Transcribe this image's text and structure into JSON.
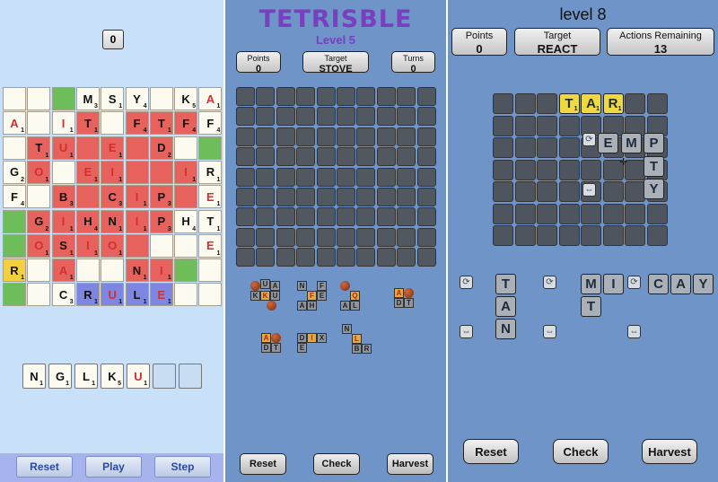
{
  "left": {
    "score": "0",
    "board_letters": [
      {
        "r": 0,
        "c": 3,
        "l": "M",
        "s": "3"
      },
      {
        "r": 0,
        "c": 4,
        "l": "S",
        "s": "1"
      },
      {
        "r": 0,
        "c": 5,
        "l": "Y",
        "s": "4"
      },
      {
        "r": 0,
        "c": 7,
        "l": "K",
        "s": "5"
      },
      {
        "r": 0,
        "c": 8,
        "l": "A",
        "s": "1",
        "red": true
      },
      {
        "r": 1,
        "c": 0,
        "l": "A",
        "s": "1",
        "red": true
      },
      {
        "r": 1,
        "c": 2,
        "l": "I",
        "s": "1",
        "red": true
      },
      {
        "r": 1,
        "c": 3,
        "l": "T",
        "s": "1"
      },
      {
        "r": 1,
        "c": 5,
        "l": "F",
        "s": "4"
      },
      {
        "r": 1,
        "c": 6,
        "l": "T",
        "s": "1"
      },
      {
        "r": 1,
        "c": 7,
        "l": "F",
        "s": "4"
      },
      {
        "r": 1,
        "c": 8,
        "l": "F",
        "s": "4"
      },
      {
        "r": 2,
        "c": 1,
        "l": "T",
        "s": "1"
      },
      {
        "r": 2,
        "c": 2,
        "l": "U",
        "s": "1",
        "red": true
      },
      {
        "r": 2,
        "c": 4,
        "l": "E",
        "s": "1",
        "red": true
      },
      {
        "r": 2,
        "c": 6,
        "l": "D",
        "s": "2"
      },
      {
        "r": 3,
        "c": 0,
        "l": "G",
        "s": "2"
      },
      {
        "r": 3,
        "c": 1,
        "l": "O",
        "s": "1",
        "red": true
      },
      {
        "r": 3,
        "c": 3,
        "l": "E",
        "s": "1",
        "red": true
      },
      {
        "r": 3,
        "c": 4,
        "l": "I",
        "s": "1",
        "red": true
      },
      {
        "r": 3,
        "c": 7,
        "l": "I",
        "s": "1",
        "red": true
      },
      {
        "r": 3,
        "c": 8,
        "l": "R",
        "s": "1"
      },
      {
        "r": 4,
        "c": 0,
        "l": "F",
        "s": "4"
      },
      {
        "r": 4,
        "c": 2,
        "l": "B",
        "s": "3"
      },
      {
        "r": 4,
        "c": 4,
        "l": "C",
        "s": "3"
      },
      {
        "r": 4,
        "c": 5,
        "l": "I",
        "s": "1",
        "red": true
      },
      {
        "r": 4,
        "c": 6,
        "l": "P",
        "s": "3"
      },
      {
        "r": 4,
        "c": 8,
        "l": "E",
        "s": "1",
        "red": true
      },
      {
        "r": 5,
        "c": 1,
        "l": "G",
        "s": "2"
      },
      {
        "r": 5,
        "c": 2,
        "l": "I",
        "s": "1",
        "red": true
      },
      {
        "r": 5,
        "c": 3,
        "l": "H",
        "s": "4"
      },
      {
        "r": 5,
        "c": 4,
        "l": "N",
        "s": "1"
      },
      {
        "r": 5,
        "c": 5,
        "l": "I",
        "s": "1",
        "red": true
      },
      {
        "r": 5,
        "c": 6,
        "l": "P",
        "s": "3"
      },
      {
        "r": 5,
        "c": 7,
        "l": "H",
        "s": "4"
      },
      {
        "r": 5,
        "c": 8,
        "l": "T",
        "s": "1"
      },
      {
        "r": 6,
        "c": 1,
        "l": "O",
        "s": "1",
        "red": true
      },
      {
        "r": 6,
        "c": 2,
        "l": "S",
        "s": "1"
      },
      {
        "r": 6,
        "c": 3,
        "l": "I",
        "s": "1",
        "red": true
      },
      {
        "r": 6,
        "c": 4,
        "l": "O",
        "s": "1",
        "red": true
      },
      {
        "r": 6,
        "c": 8,
        "l": "E",
        "s": "1",
        "red": true
      },
      {
        "r": 7,
        "c": 0,
        "l": "R",
        "s": "1"
      },
      {
        "r": 7,
        "c": 2,
        "l": "A",
        "s": "1",
        "red": true
      },
      {
        "r": 7,
        "c": 5,
        "l": "N",
        "s": "1"
      },
      {
        "r": 7,
        "c": 6,
        "l": "I",
        "s": "1",
        "red": true
      },
      {
        "r": 8,
        "c": 2,
        "l": "C",
        "s": "3"
      },
      {
        "r": 8,
        "c": 3,
        "l": "R",
        "s": "1"
      },
      {
        "r": 8,
        "c": 4,
        "l": "U",
        "s": "1",
        "red": true
      },
      {
        "r": 8,
        "c": 5,
        "l": "L",
        "s": "1"
      },
      {
        "r": 8,
        "c": 6,
        "l": "E",
        "s": "1",
        "red": true
      }
    ],
    "rack": [
      {
        "l": "N",
        "s": "1"
      },
      {
        "l": "G",
        "s": "1"
      },
      {
        "l": "L",
        "s": "1"
      },
      {
        "l": "K",
        "s": "5"
      },
      {
        "l": "U",
        "s": "1",
        "red": true
      },
      {
        "l": "",
        "s": ""
      },
      {
        "l": "",
        "s": ""
      }
    ],
    "buttons": {
      "reset": "Reset",
      "play": "Play",
      "step": "Step"
    }
  },
  "middle": {
    "title": "TETRISBLE",
    "level": "Level 5",
    "points_label": "Points",
    "points": "0",
    "target_label": "Target",
    "target": "STOVE",
    "turns_label": "Turns",
    "turns": "0",
    "pieces": [
      [
        "U",
        "A",
        "K",
        "U"
      ],
      [
        "N",
        "F",
        "F",
        "E",
        "A",
        "H"
      ],
      [
        "Q",
        "A",
        "L"
      ],
      [
        "A",
        "D",
        "T"
      ],
      [
        "A",
        "D",
        "T"
      ],
      [
        "D",
        "I",
        "X",
        "E"
      ],
      [
        "N",
        "L",
        "B",
        "R"
      ]
    ],
    "buttons": {
      "reset": "Reset",
      "check": "Check",
      "harvest": "Harvest"
    }
  },
  "right": {
    "level": "level 8",
    "points_label": "Points",
    "points": "0",
    "target_label": "Target",
    "target": "REACT",
    "actions_label": "Actions Remaining",
    "actions": "13",
    "board_word": [
      {
        "l": "T",
        "s": "1"
      },
      {
        "l": "A",
        "s": "1"
      },
      {
        "l": "R",
        "s": "1"
      }
    ],
    "floating": [
      "E",
      "M",
      "P",
      "T",
      "Y"
    ],
    "pieces": [
      "T",
      "A",
      "N",
      "M",
      "I",
      "C",
      "A",
      "Y",
      "T"
    ],
    "buttons": {
      "reset": "Reset",
      "check": "Check",
      "harvest": "Harvest"
    }
  },
  "colors": {
    "green": "#6dbd5a",
    "red": "#e7625c",
    "yellow": "#f4d03f",
    "blue": "#7d86e0",
    "red_letter": "#d23030"
  }
}
